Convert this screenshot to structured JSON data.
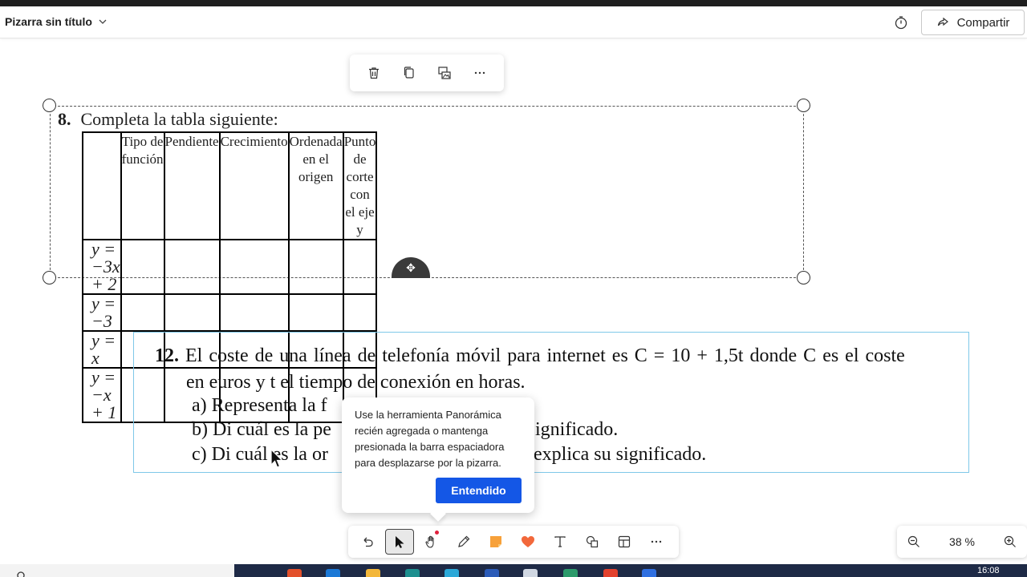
{
  "header": {
    "title": "Pizarra sin título",
    "share_label": "Compartir"
  },
  "icons": {
    "title_dropdown": "chevron-down-icon",
    "timer": "timer-icon",
    "share": "share-icon"
  },
  "float_toolbar": [
    "delete-icon",
    "copy-icon",
    "image-swap-icon",
    "more-icon"
  ],
  "exercise8": {
    "number": "8.",
    "title": "Completa la tabla siguiente:",
    "headers": [
      "Tipo de función",
      "Pendiente",
      "Crecimiento",
      "Ordenada en el origen",
      "Punto de corte con el eje y"
    ],
    "functions": [
      "y = −3x + 2",
      "y = −3",
      "y = x",
      "y = −x + 1"
    ]
  },
  "exercise12": {
    "number": "12.",
    "line1": "El coste de una línea de telefonía móvil para internet es  C = 10 + 1,5t  donde C es el coste",
    "line2": "en euros y t el tiempo de conexión en horas.",
    "items": [
      {
        "prefix": "a)",
        "visible": "Representa la f"
      },
      {
        "prefix": "b)",
        "visible_left": "Di cuál es la pe",
        "visible_right": "ignificado."
      },
      {
        "prefix": "c)",
        "visible_left": "Di cuál es la or",
        "visible_right": "explica su significado."
      }
    ]
  },
  "tooltip": {
    "text": "Use la herramienta Panorámica recién agregada o mantenga presionada la barra espaciadora para desplazarse por la pizarra.",
    "button": "Entendido"
  },
  "bottom_toolbar": {
    "tools": [
      "undo-icon",
      "select-icon",
      "pan-hand-icon",
      "pen-icon",
      "sticky-note-icon",
      "reaction-heart-icon",
      "text-icon",
      "shapes-icon",
      "templates-icon",
      "more-icon"
    ],
    "active": "select-icon"
  },
  "zoom": {
    "value": "38 %"
  },
  "taskbar": {
    "clock": "16:08"
  },
  "colors": {
    "accent_button": "#1457e6",
    "exercise12_border": "#7fc8e8",
    "heart": "#f2683b",
    "sticky": "#f7a13a"
  }
}
